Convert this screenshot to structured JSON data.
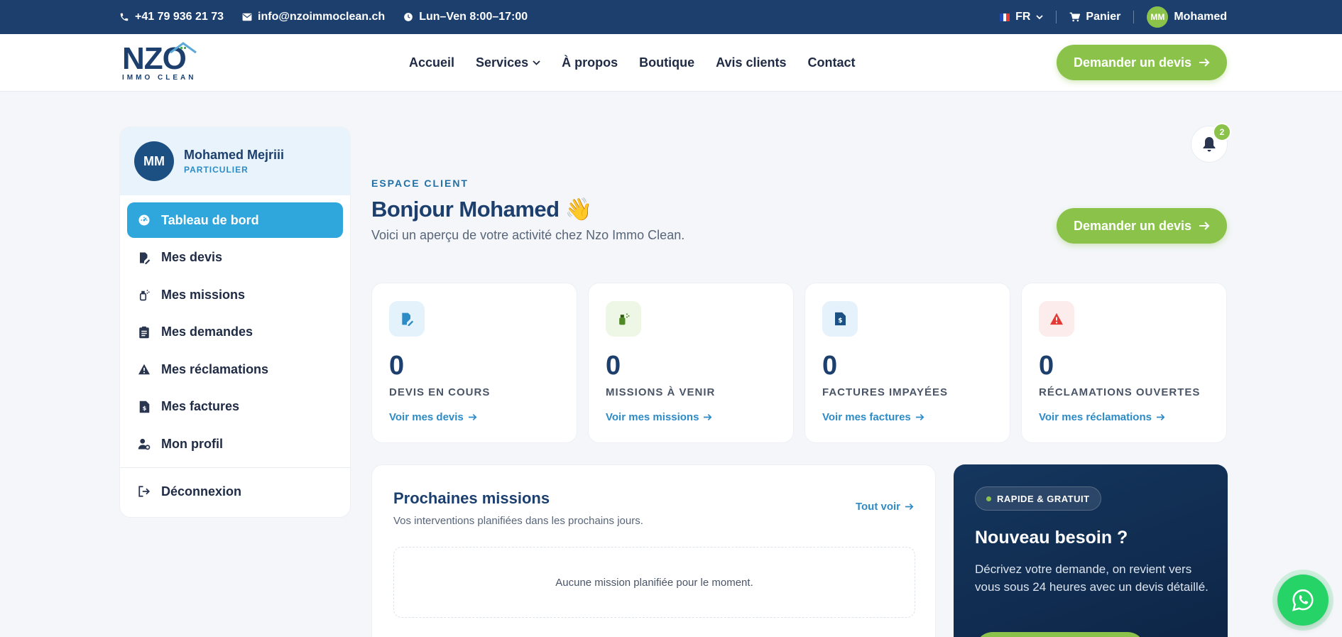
{
  "topbar": {
    "phone": "+41 79 936 21 73",
    "email": "info@nzoimmoclean.ch",
    "hours": "Lun–Ven 8:00–17:00",
    "language": "FR",
    "cart": "Panier",
    "user_initials": "MM",
    "user_name": "Mohamed"
  },
  "header": {
    "logo_main": "NZO",
    "logo_sub": "IMMO CLEAN",
    "nav": [
      "Accueil",
      "Services",
      "À propos",
      "Boutique",
      "Avis clients",
      "Contact"
    ],
    "cta": "Demander un devis"
  },
  "sidebar": {
    "initials": "MM",
    "name": "Mohamed Mejriii",
    "role": "PARTICULIER",
    "items": [
      {
        "label": "Tableau de bord",
        "icon": "dashboard-icon"
      },
      {
        "label": "Mes devis",
        "icon": "quote-edit-icon"
      },
      {
        "label": "Mes missions",
        "icon": "spray-icon"
      },
      {
        "label": "Mes demandes",
        "icon": "clipboard-icon"
      },
      {
        "label": "Mes réclamations",
        "icon": "warning-icon"
      },
      {
        "label": "Mes factures",
        "icon": "invoice-icon"
      },
      {
        "label": "Mon profil",
        "icon": "user-gear-icon"
      }
    ],
    "logout": "Déconnexion"
  },
  "main": {
    "notification_count": "2",
    "eyebrow": "ESPACE CLIENT",
    "greeting": "Bonjour Mohamed 👋",
    "subtitle": "Voici un aperçu de votre activité chez Nzo Immo Clean.",
    "cta": "Demander un devis",
    "stats": [
      {
        "value": "0",
        "label": "DEVIS EN COURS",
        "link": "Voir mes devis",
        "icon": "quote-edit-icon",
        "color": "#2d8bc6",
        "bg": "#e3f2fb"
      },
      {
        "value": "0",
        "label": "MISSIONS À VENIR",
        "link": "Voir mes missions",
        "icon": "spray-icon",
        "color": "#4f8a25",
        "bg": "#eef6e6"
      },
      {
        "value": "0",
        "label": "FACTURES IMPAYÉES",
        "link": "Voir mes factures",
        "icon": "invoice-icon",
        "color": "#1c4f82",
        "bg": "#e5f2fb"
      },
      {
        "value": "0",
        "label": "RÉCLAMATIONS OUVERTES",
        "link": "Voir mes réclamations",
        "icon": "warning-icon",
        "color": "#e53935",
        "bg": "#fdecec"
      }
    ],
    "missions": {
      "title": "Prochaines missions",
      "subtitle": "Vos interventions planifiées dans les prochains jours.",
      "see_all": "Tout voir",
      "empty": "Aucune mission planifiée pour le moment."
    },
    "promo": {
      "badge": "RAPIDE & GRATUIT",
      "title": "Nouveau besoin ?",
      "text": "Décrivez votre demande, on revient vers vous sous 24 heures avec un devis détaillé."
    }
  },
  "colors": {
    "primary": "#1c3f6e",
    "accent": "#8bc34a",
    "active": "#2fa6dc",
    "link": "#2d8bc6"
  }
}
